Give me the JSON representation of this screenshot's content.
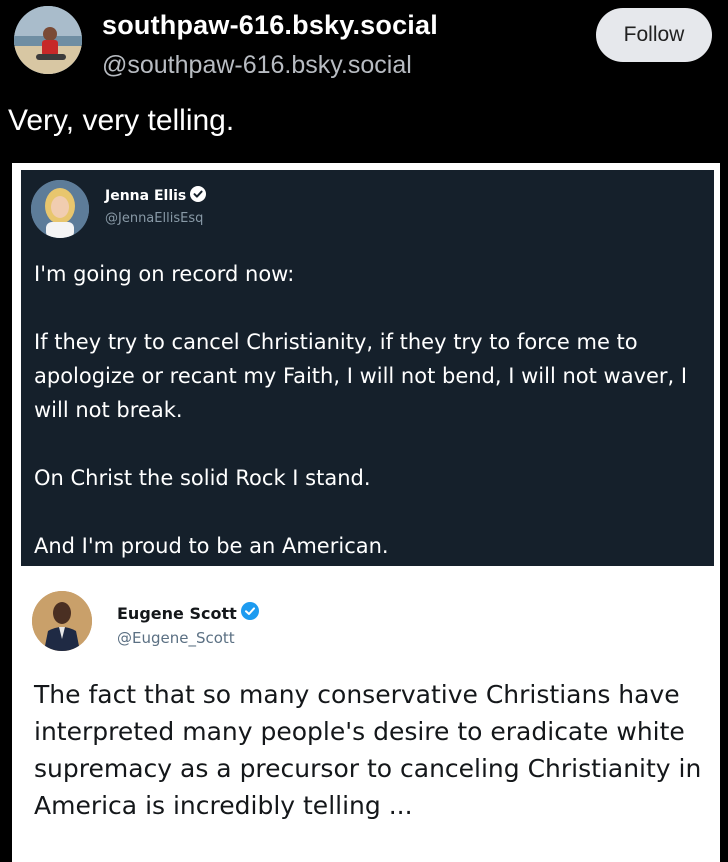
{
  "post": {
    "display_name": "southpaw-616.bsky.social",
    "handle": "@southpaw-616.bsky.social",
    "follow_label": "Follow",
    "text": "Very, very telling."
  },
  "quoted_tweet_1": {
    "name": "Jenna Ellis",
    "handle": "@JennaEllisEsq",
    "verified_icon": "verified-badge-icon",
    "paragraphs": [
      "I'm going on record now:",
      "If they try to cancel Christianity, if they try to force me to apologize or recant my Faith, I will not bend, I will not waver, I will not break.",
      "On Christ the solid Rock I stand.",
      "And I'm proud to be an American."
    ]
  },
  "quoted_tweet_2": {
    "name": "Eugene Scott",
    "handle": "@Eugene_Scott",
    "verified_icon": "verified-badge-icon",
    "text": "The fact that so many conservative Christians have interpreted many people's desire to eradicate white supremacy as a precursor to canceling Christianity in America is incredibly telling ..."
  },
  "colors": {
    "background": "#000000",
    "follow_button_bg": "#e6e8ec",
    "dark_tweet_bg": "#15202b",
    "verified_blue": "#1d9bf0",
    "handle_gray": "#b8bcc2"
  }
}
